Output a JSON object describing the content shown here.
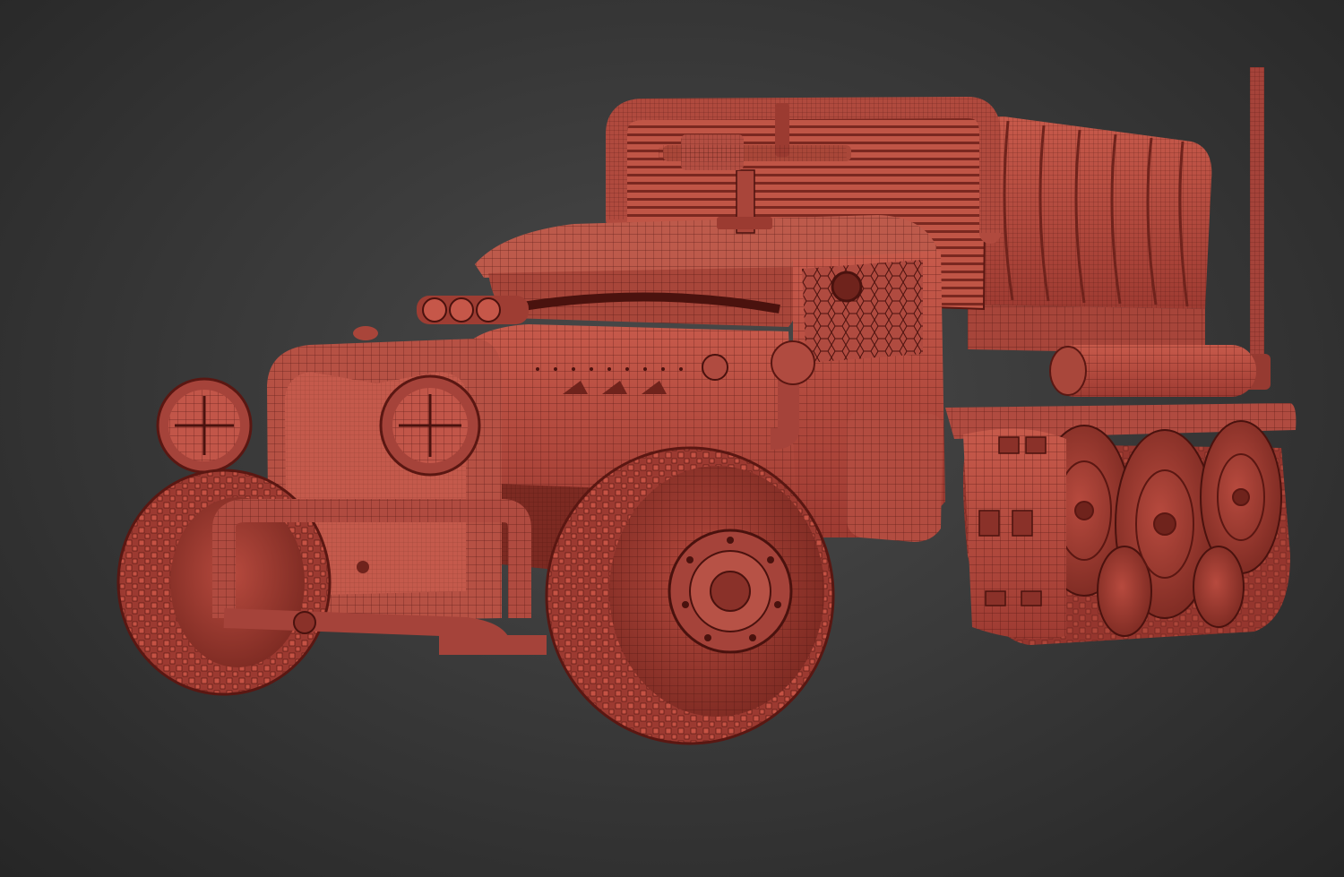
{
  "viewport": {
    "background_color": "#3a3a3a",
    "model_color": "#b5493f",
    "wire_color": "#5a1712",
    "subject": "wireframe-red-offroad-truck-model"
  }
}
